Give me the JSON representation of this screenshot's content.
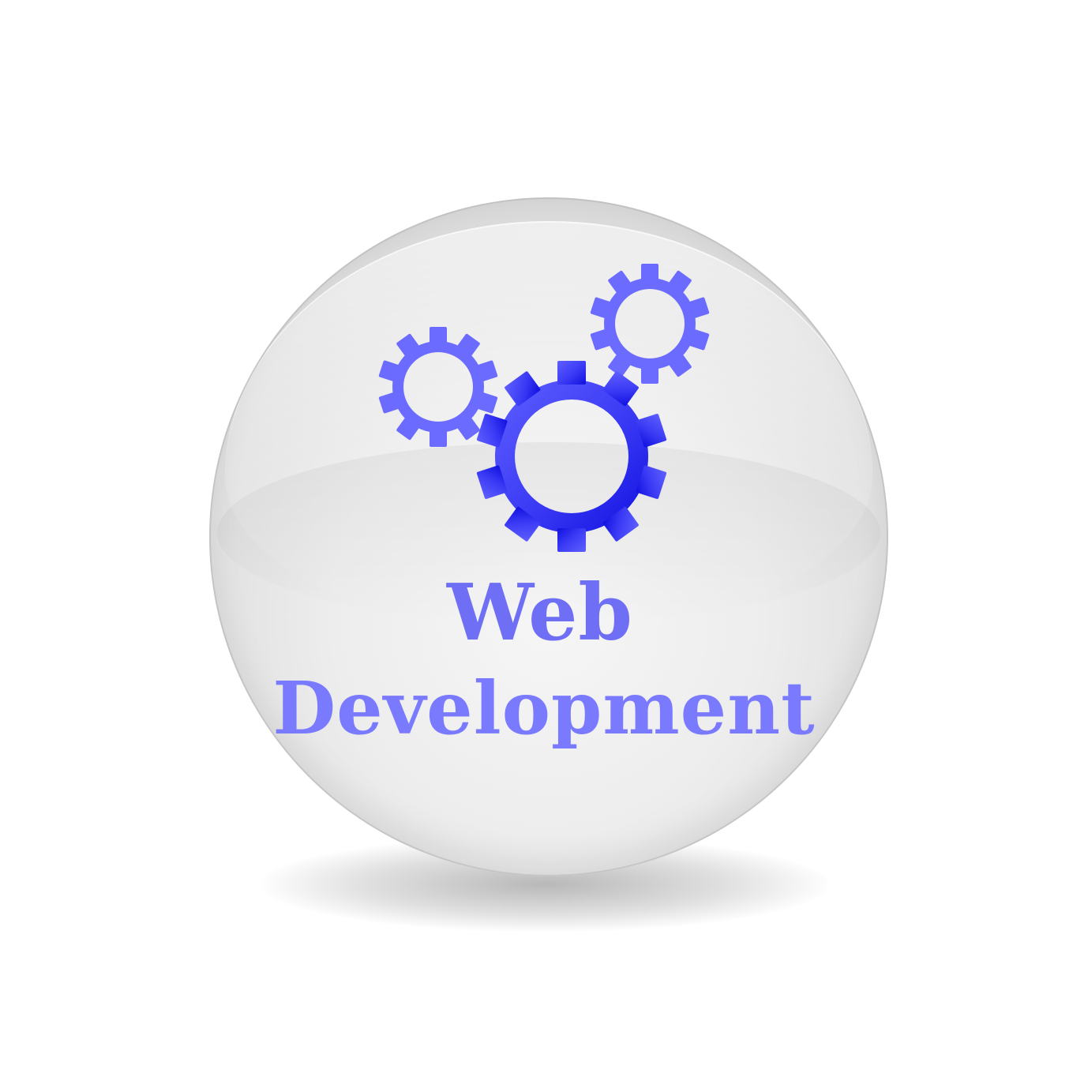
{
  "label": {
    "line1": "Web",
    "line2": "Development"
  },
  "icons": [
    "gear-icon",
    "gear-icon",
    "gear-icon"
  ],
  "colors": {
    "gear_light": "#6b6bff",
    "gear_dark": "#1b1be6",
    "text": "#7a7aff",
    "orb": "#e9e9e9",
    "background": "#ffffff"
  }
}
